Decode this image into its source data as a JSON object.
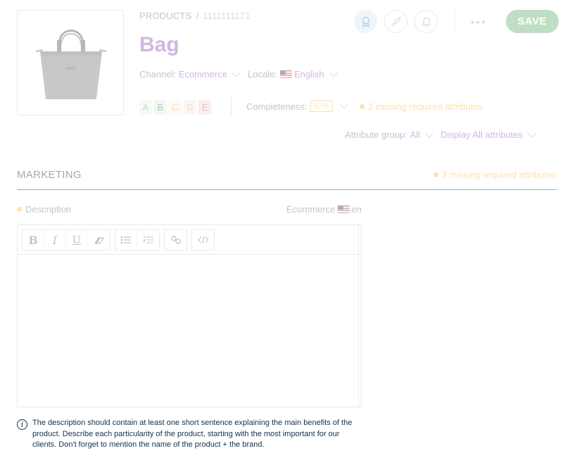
{
  "breadcrumb": {
    "section": "PRODUCTS",
    "separator": "/",
    "sku": "1111111171"
  },
  "product": {
    "title": "Bag"
  },
  "context": {
    "channel_label": "Channel:",
    "channel_value": "Ecommerce",
    "locale_label": "Locale:",
    "locale_value": "English"
  },
  "grades": [
    "A",
    "B",
    "C",
    "D",
    "E"
  ],
  "completeness": {
    "label": "Completeness:",
    "percent": "57%",
    "missing": "3 missing required attributes"
  },
  "actions": {
    "more": "•••",
    "save": "SAVE"
  },
  "filters": {
    "group_label": "Attribute group:",
    "group_value": "All",
    "display_value": "Display All attributes"
  },
  "section": {
    "title": "MARKETING",
    "missing": "3 missing required attributes"
  },
  "field": {
    "label": "Description",
    "scope_channel": "Ecommerce",
    "scope_locale": "en"
  },
  "toolbar": {
    "bold": "B",
    "italic": "I",
    "underline": "U"
  },
  "help": {
    "icon": "i",
    "text": "The description should contain at least one short sentence explaining the main benefits of the product. Describe each particularity of the product, starting with the most important for our clients. Don't forget to mention the name of the product + the brand."
  },
  "colors": {
    "brand": "#9452ba",
    "success": "#67b373",
    "warning": "#f9b53f",
    "text": "#67768a",
    "dark": "#11324d"
  },
  "icons": [
    "bag-photo",
    "badge-icon",
    "rocket-icon",
    "bell-icon",
    "more-icon",
    "eraser-icon",
    "bullet-list-icon",
    "numbered-list-icon",
    "link-icon",
    "code-icon",
    "info-icon"
  ]
}
